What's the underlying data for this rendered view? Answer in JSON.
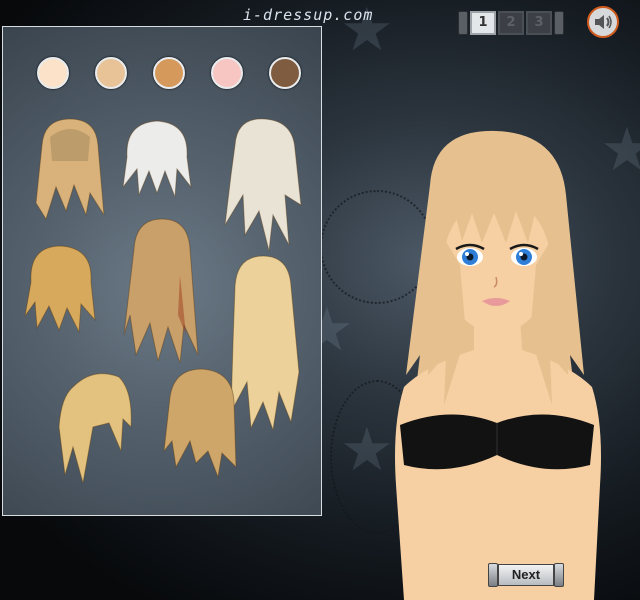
{
  "brand": {
    "logo_text": "i-dressup.com"
  },
  "page_tabs": [
    {
      "label": "1",
      "active": true
    },
    {
      "label": "2",
      "active": false
    },
    {
      "label": "3",
      "active": false
    }
  ],
  "sound_button": {
    "icon": "speaker-icon"
  },
  "hair_colors": [
    "#fbe2c8",
    "#e9c398",
    "#d6995c",
    "#f7c6c2",
    "#7f5c3f"
  ],
  "hairstyles": [
    {
      "name": "straight-fringe-medium",
      "shade": "#d8b27a"
    },
    {
      "name": "short-spiky-platinum",
      "shade": "#ececea"
    },
    {
      "name": "long-layered-platinum",
      "shade": "#e9e3d6"
    },
    {
      "name": "short-messy-golden",
      "shade": "#d7a95c"
    },
    {
      "name": "long-wavy-caramel",
      "shade": "#c9a06a"
    },
    {
      "name": "long-straight-light",
      "shade": "#ecd29a"
    },
    {
      "name": "side-swept-bob",
      "shade": "#e2c27e"
    },
    {
      "name": "layered-bob-honey",
      "shade": "#cfa66a"
    }
  ],
  "model": {
    "hair_color": "#e6c18f",
    "skin_color": "#f6cfa2",
    "eye_color": "#2f7fd8",
    "top_color": "#121212"
  },
  "next_button": {
    "label": "Next"
  }
}
